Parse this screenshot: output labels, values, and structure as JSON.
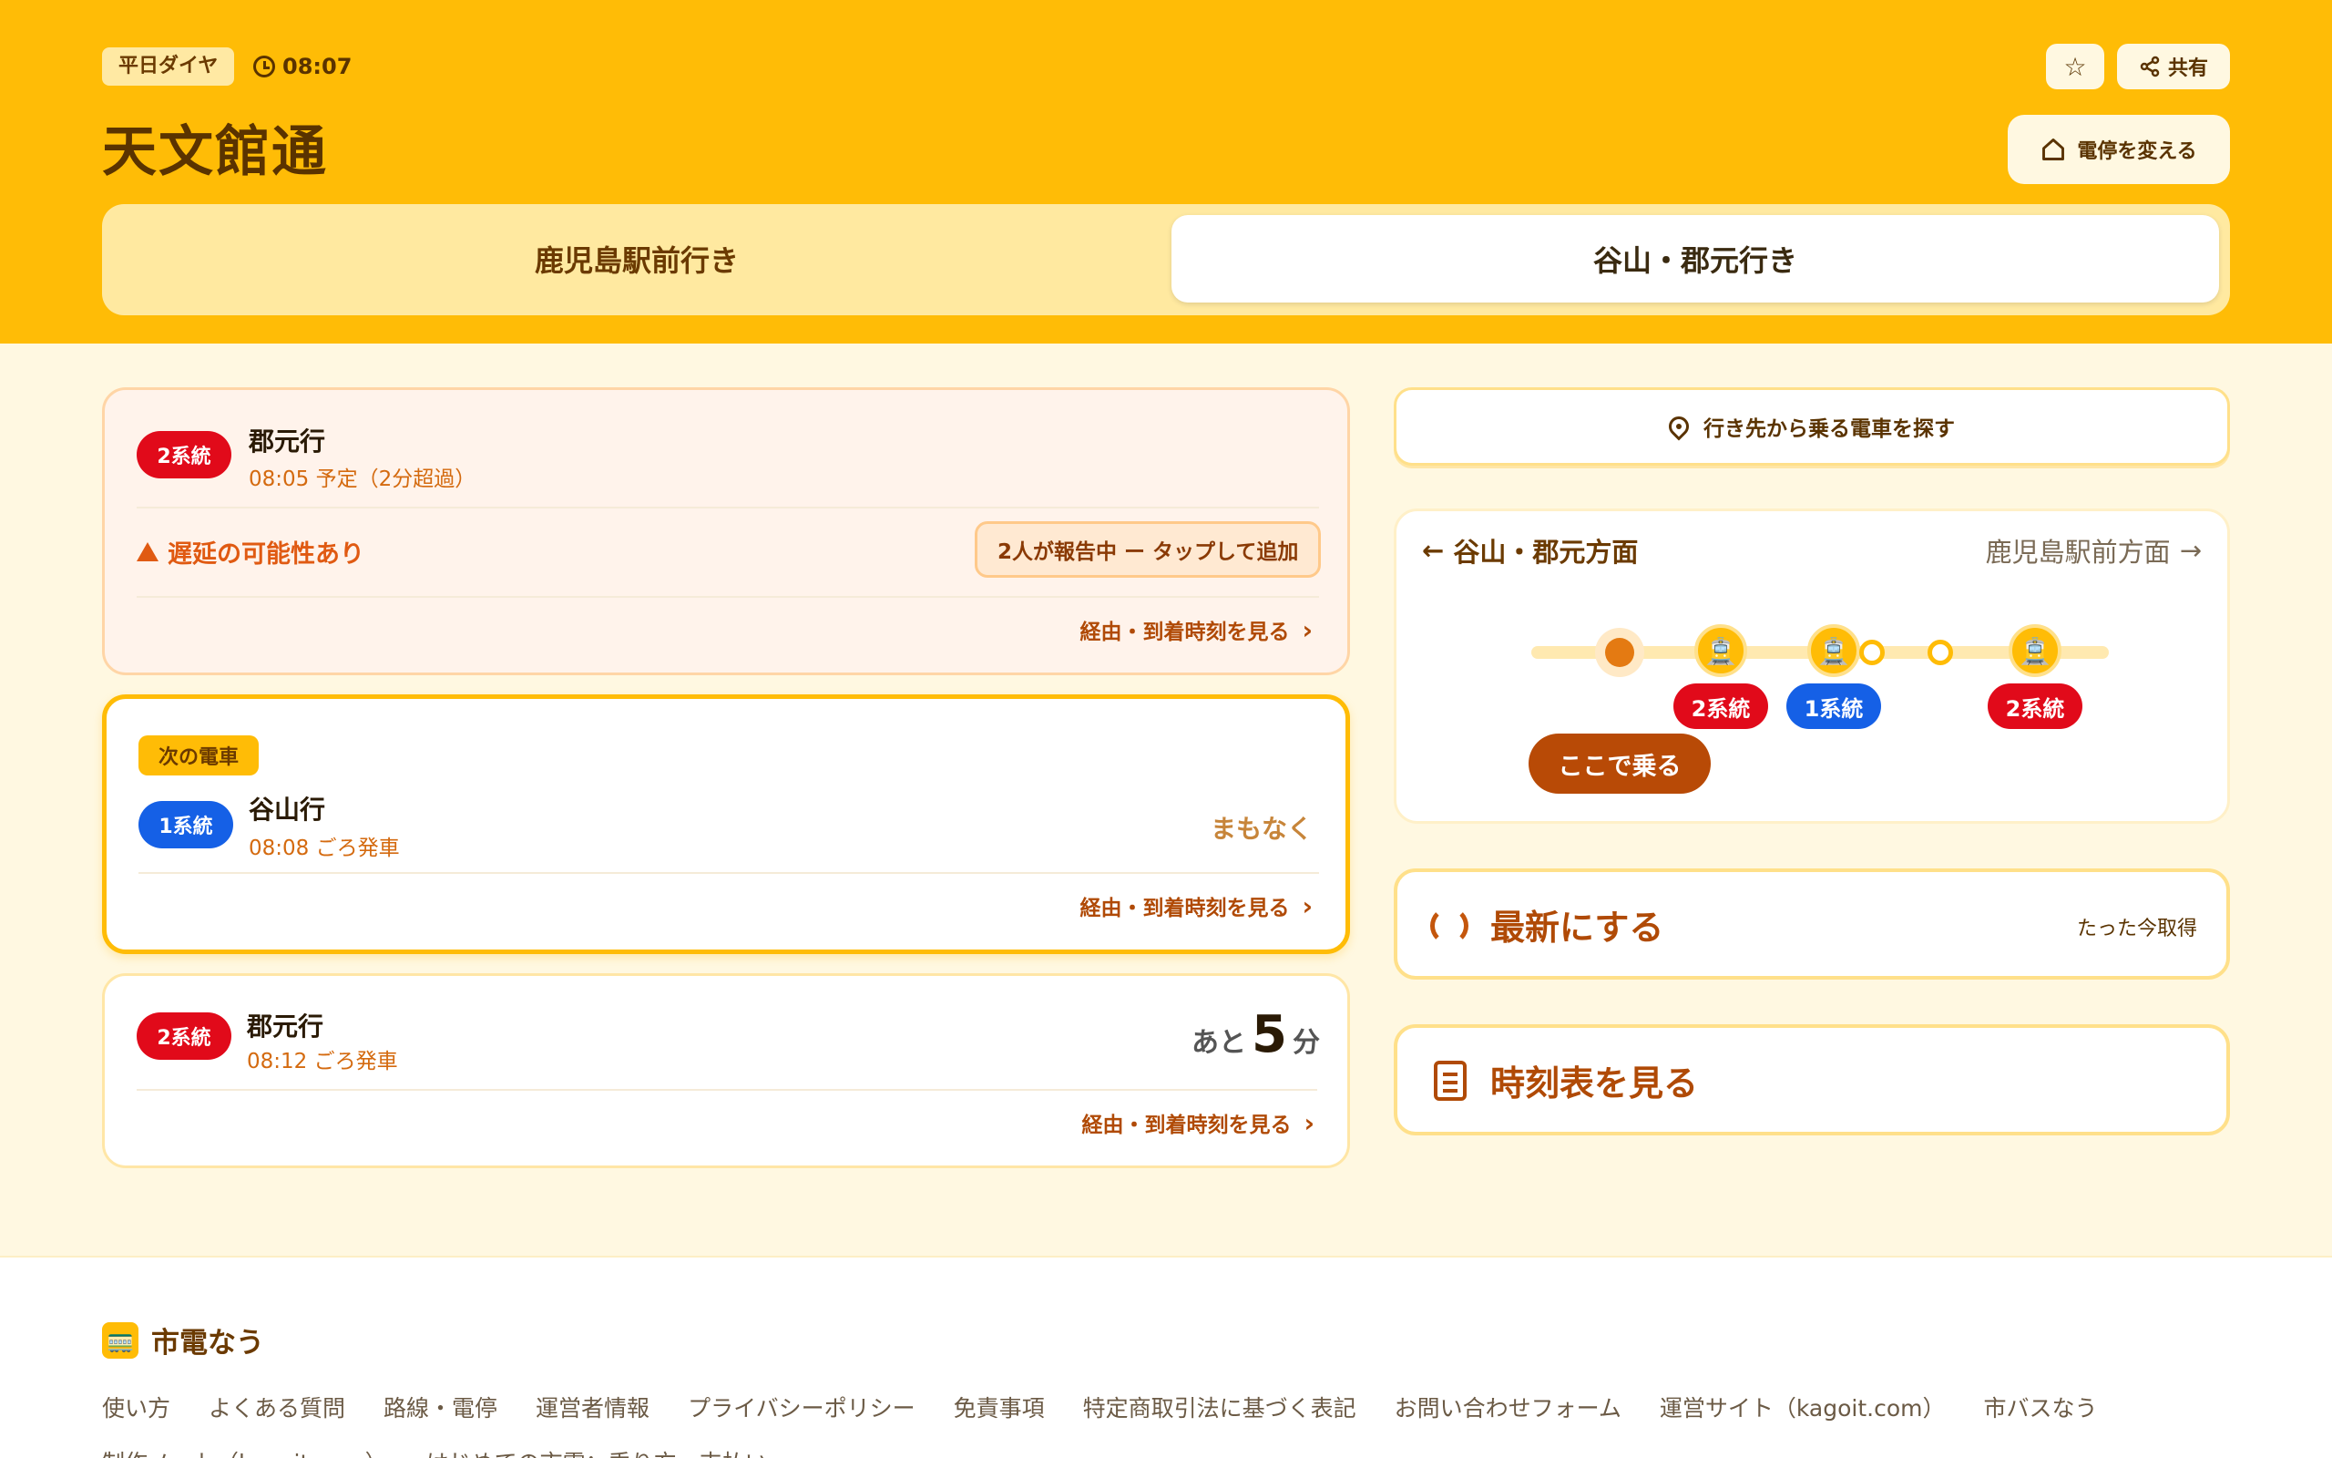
{
  "header": {
    "day_type": "平日ダイヤ",
    "time": "08:07",
    "stop_name": "天文館通",
    "share_label": "共有",
    "change_stop_label": "電停を変える",
    "tabs": [
      "鹿児島駅前行き",
      "谷山・郡元行き"
    ],
    "active_tab": "谷山・郡元行き"
  },
  "departures": [
    {
      "line": "2系統",
      "line_color": "#e10a1a",
      "destination": "郡元行",
      "time_text": "08:05 予定（2分超過）",
      "warning": "遅延の可能性あり",
      "report_button": "2人が報告中 ー タップして追加",
      "route_link": "経由・到着時刻を見る"
    },
    {
      "tag": "次の電車",
      "line": "1系統",
      "line_color": "#1560e6",
      "destination": "谷山行",
      "time_text": "08:08 ごろ発車",
      "status": "まもなく",
      "route_link": "経由・到着時刻を見る"
    },
    {
      "line": "2系統",
      "line_color": "#e10a1a",
      "destination": "郡元行",
      "time_text": "08:12 ごろ発車",
      "remain_prefix": "あと",
      "remain_minutes": "5",
      "remain_unit": "分",
      "route_link": "経由・到着時刻を見る"
    }
  ],
  "side": {
    "search_label": "行き先から乗る電車を探す",
    "map": {
      "left_direction": "谷山・郡元方面",
      "right_direction": "鹿児島駅前方面",
      "trams": [
        {
          "line": "2系統",
          "color": "#e10a1a"
        },
        {
          "line": "1系統",
          "color": "#1560e6"
        },
        {
          "line": "2系統",
          "color": "#e10a1a"
        }
      ],
      "board_here": "ここで乗る"
    },
    "refresh_label": "最新にする",
    "refresh_time": "たった今取得",
    "timetable_label": "時刻表を見る"
  },
  "footer": {
    "brand": "市電なう",
    "links": [
      "使い方",
      "よくある質問",
      "路線・電停",
      "運営者情報",
      "プライバシーポリシー",
      "免責事項",
      "特定商取引法に基づく表記",
      "お問い合わせフォーム",
      "運営サイト（kagoit.com）",
      "市バスなう",
      "制作ノート（kagoit.com）",
      "はじめての市電：乗り方・支払い"
    ]
  },
  "colors": {
    "header_bg": "#ffbc06",
    "page_bg": "#fff8e1",
    "accent_dark": "#b04a06",
    "line_red": "#e10a1a",
    "line_blue": "#1560e6"
  }
}
